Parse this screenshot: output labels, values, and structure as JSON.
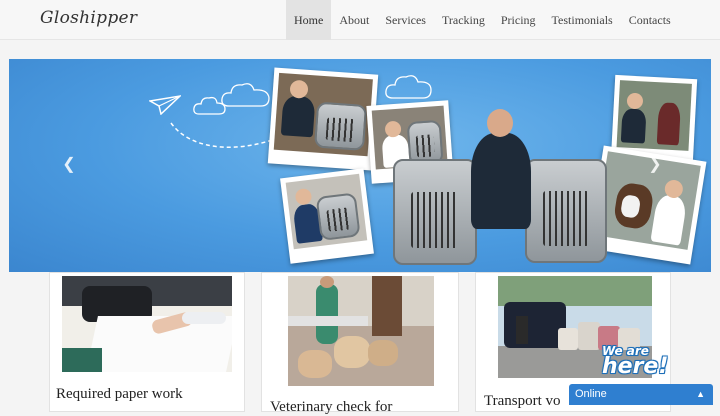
{
  "brand": {
    "logo_text": "Gloshipper"
  },
  "nav": {
    "items": [
      {
        "label": "Home",
        "active": true
      },
      {
        "label": "Services",
        "active": false
      },
      {
        "label": "Tracking",
        "active": false
      },
      {
        "label": "Pricing",
        "active": false
      },
      {
        "label": "Testimonials",
        "active": false
      },
      {
        "label": "Contacts",
        "active": false
      }
    ],
    "about_label": "About"
  },
  "hero": {
    "prev_icon": "chevron-left-icon",
    "next_icon": "chevron-right-icon",
    "background_color": "#4b9be0"
  },
  "cards": [
    {
      "title": "Required paper work",
      "image": "signing-documents-photo"
    },
    {
      "title": "Veterinary check for",
      "image": "vet-with-dogs-photo"
    },
    {
      "title": "Transport vo",
      "image": "van-with-crates-photo"
    }
  ],
  "chat": {
    "badge_line1": "We are",
    "badge_line2": "here!",
    "status": "Online",
    "accent": "#2f7fd0"
  }
}
